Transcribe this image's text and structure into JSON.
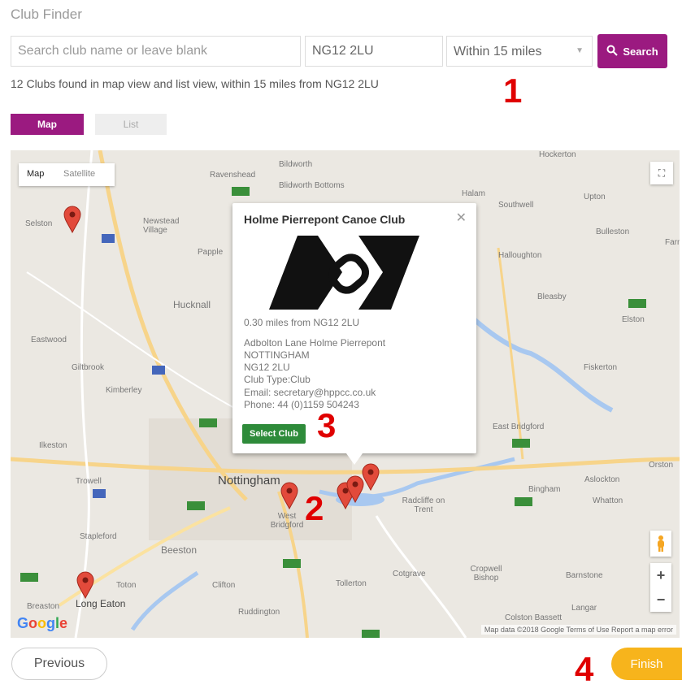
{
  "page": {
    "title": "Club Finder"
  },
  "search": {
    "name_placeholder": "Search club name or leave blank",
    "postcode_value": "NG12 2LU",
    "radius_selected": "Within 15 miles",
    "button_label": "Search"
  },
  "results_text": "12 Clubs found in map view and list view, within 15 miles from NG12 2LU",
  "view_tabs": {
    "map": "Map",
    "list": "List"
  },
  "map": {
    "type_controls": {
      "map": "Map",
      "satellite": "Satellite"
    },
    "places": [
      "Bildworth",
      "Hockerton",
      "Ravenshead",
      "Blidworth Bottoms",
      "Halam",
      "Southwell",
      "Upton",
      "Selston",
      "Newstead Village",
      "Bulleston",
      "Farnd",
      "Papple",
      "Halloughton",
      "Hucknall",
      "Bleasby",
      "Elston",
      "Eastwood",
      "Giltbrook",
      "Fiskerton",
      "Kimberley",
      "East Bridgford",
      "Ilkeston",
      "Orston",
      "Trowell",
      "Nottingham",
      "Bingham",
      "Aslockton",
      "West Bridgford",
      "Radcliffe on Trent",
      "Whatton",
      "Stapleford",
      "Beeston",
      "Cropwell Bishop",
      "Cotgrave",
      "Tollerton",
      "Clifton",
      "Toton",
      "Barnstone",
      "Langar",
      "Long Eaton",
      "Breaston",
      "Ruddington",
      "Colston Bassett"
    ],
    "attribution": "Map data ©2018 Google   Terms of Use   Report a map error",
    "google_logo": "Google"
  },
  "popup": {
    "title": "Holme Pierrepont Canoe Club",
    "distance": "0.30 miles from NG12 2LU",
    "address_line1": "Adbolton Lane Holme Pierrepont",
    "address_line2": "NOTTINGHAM",
    "address_line3": "NG12 2LU",
    "club_type": "Club Type:Club",
    "email": "Email: secretary@hppcc.co.uk",
    "phone": "Phone: 44 (0)1159 504243",
    "select_label": "Select Club"
  },
  "annotations": [
    "1",
    "2",
    "3",
    "4"
  ],
  "nav": {
    "previous": "Previous",
    "finish": "Finish"
  },
  "colors": {
    "accent": "#9b1a80",
    "select_green": "#2e8b3a",
    "finish_yellow": "#f7b41c",
    "annotation_red": "#e00000"
  }
}
